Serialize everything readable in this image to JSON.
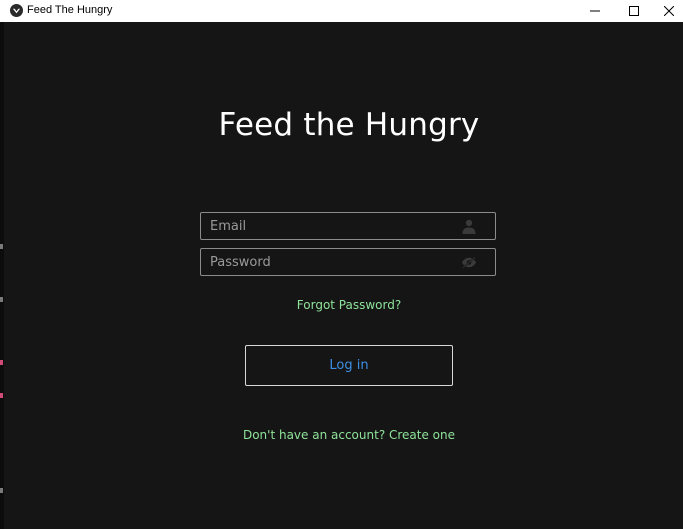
{
  "window": {
    "title": "Feed The Hungry",
    "icon": "app-logo-icon",
    "controls": [
      "minimize-icon",
      "maximize-icon",
      "close-icon"
    ]
  },
  "login": {
    "heading": "Feed the Hungry",
    "email_placeholder": "Email",
    "email_value": "",
    "email_icon": "user-icon",
    "password_placeholder": "Password",
    "password_value": "",
    "password_icon": "eye-off-icon",
    "forgot_label": "Forgot Password?",
    "login_label": "Log in",
    "signup_label": "Don't have an account? Create one"
  },
  "colors": {
    "background": "#151515",
    "heading": "#ffffff",
    "link": "#8fe39a",
    "button_text": "#3d8fe6",
    "field_border": "#8c8c8c"
  }
}
